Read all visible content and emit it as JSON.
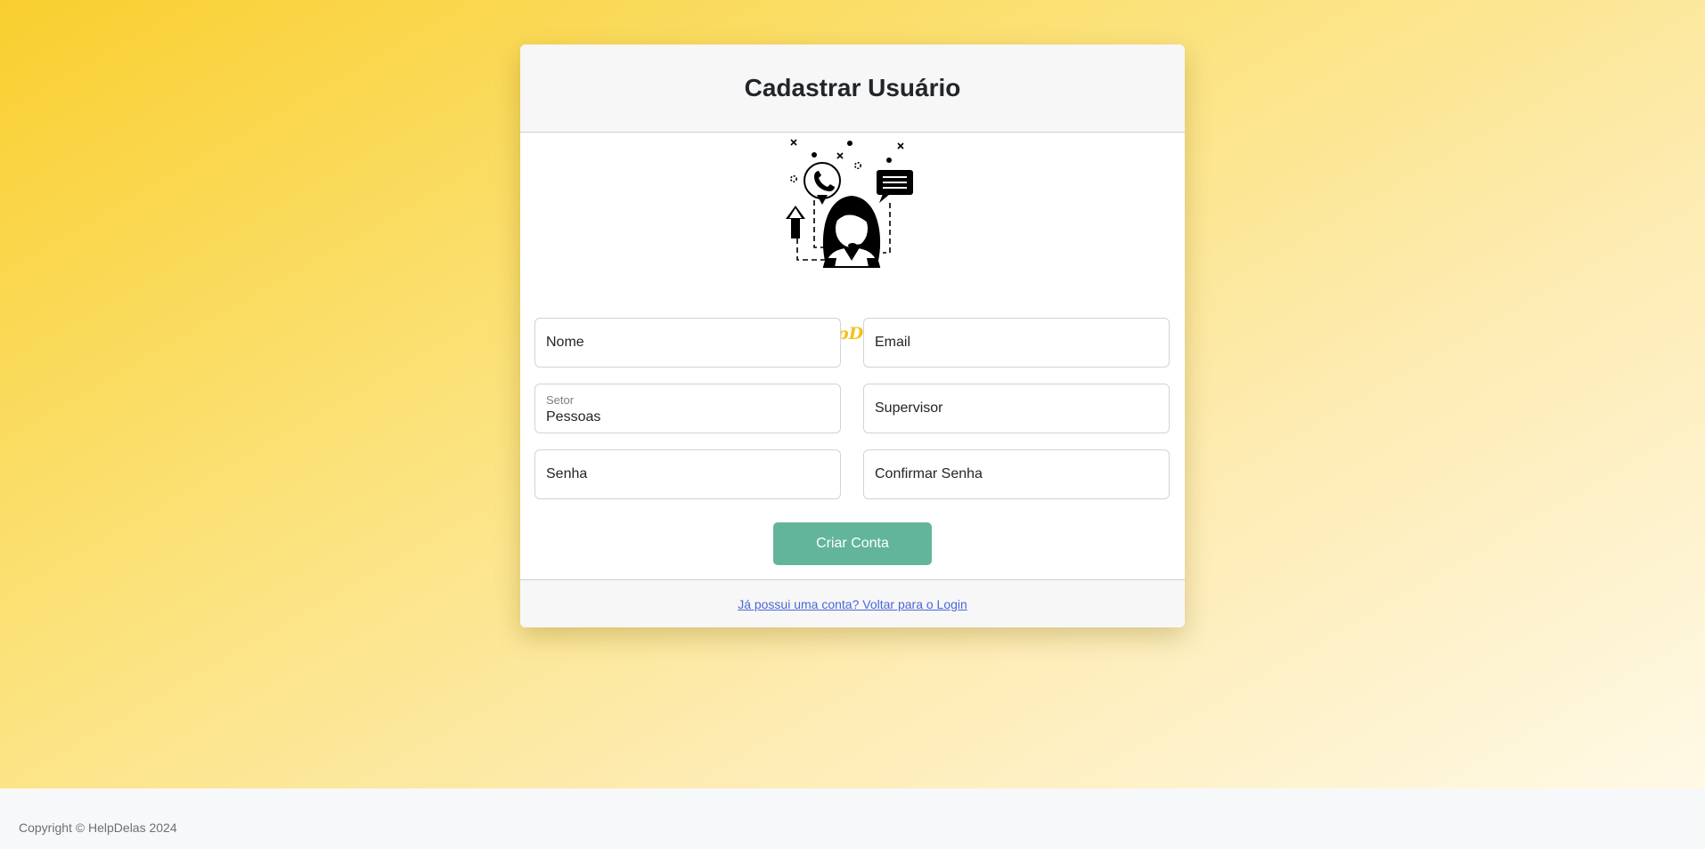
{
  "page": {
    "brand_color": "#f2c21b",
    "accent_button_color": "#62b59a"
  },
  "card": {
    "title": "Cadastrar Usuário",
    "logo": {
      "icon": "support-agent-headset-icon",
      "text": "HelpDelas"
    },
    "form": {
      "nome_placeholder": "Nome",
      "email_placeholder": "Email",
      "setor": {
        "label": "Setor",
        "value": "Pessoas"
      },
      "supervisor_placeholder": "Supervisor",
      "senha_placeholder": "Senha",
      "confirmar_senha_placeholder": "Confirmar Senha",
      "submit_label": "Criar Conta"
    },
    "footer": {
      "login_link": "Já possui uma conta? Voltar para o Login"
    }
  },
  "footer": {
    "copyright": "Copyright © HelpDelas 2024"
  }
}
